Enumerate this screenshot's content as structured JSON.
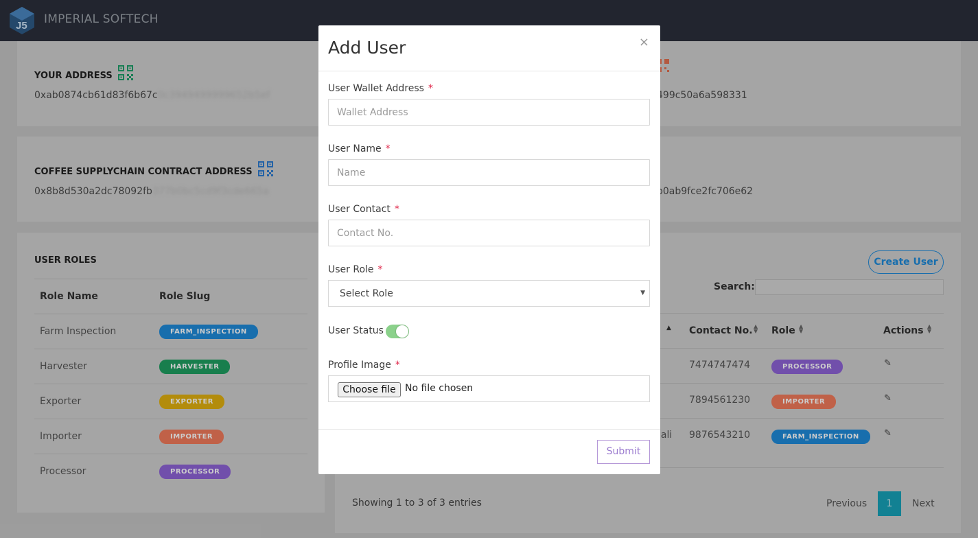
{
  "brand": {
    "name": "IMPERIAL SOFTECH"
  },
  "addresses": {
    "your_address_title": "YOUR ADDRESS",
    "your_address_value": "0xab0874cb61d83f6b67c",
    "your_address_hidden": "0c3949499999652b5ef",
    "right_top_value": "499c50a6a598331",
    "contract_title": "COFFEE SUPPLYCHAIN CONTRACT ADDRESS",
    "contract_value": "0x8b8d530a2dc78092fb",
    "contract_hidden": "377b0bc5cd9f3cde665a",
    "right_bottom_value": "b0ab9fce2fc706e62"
  },
  "user_roles": {
    "title": "USER ROLES",
    "headers": [
      "Role Name",
      "Role Slug"
    ],
    "rows": [
      {
        "name": "Farm Inspection",
        "slug": "FARM_INSPECTION",
        "color": "#1f8ad9"
      },
      {
        "name": "Harvester",
        "slug": "HARVESTER",
        "color": "#1f9e61"
      },
      {
        "name": "Exporter",
        "slug": "EXPORTER",
        "color": "#e0b010"
      },
      {
        "name": "Importer",
        "slug": "IMPORTER",
        "color": "#f07a5a"
      },
      {
        "name": "Processor",
        "slug": "PROCESSOR",
        "color": "#8e63d6"
      }
    ]
  },
  "users": {
    "create_button": "Create User",
    "search_label": "Search:",
    "search_value": "",
    "headers": [
      "Contact No.",
      "Role",
      "Actions"
    ],
    "rows": [
      {
        "name_tail": "",
        "contact": "7474747474",
        "role": "PROCESSOR",
        "role_color": "#8e63d6"
      },
      {
        "name_tail": "",
        "contact": "7894561230",
        "role": "IMPORTER",
        "role_color": "#f07a5a"
      },
      {
        "name_tail": "nali",
        "contact": "9876543210",
        "role": "FARM_INSPECTION",
        "role_color": "#1f8ad9"
      }
    ],
    "showing": "Showing 1 to 3 of 3 entries",
    "pagination": {
      "previous": "Previous",
      "page": "1",
      "next": "Next"
    }
  },
  "modal": {
    "title": "Add User",
    "close": "×",
    "wallet_label": "User Wallet Address",
    "wallet_placeholder": "Wallet Address",
    "name_label": "User Name",
    "name_placeholder": "Name",
    "contact_label": "User Contact",
    "contact_placeholder": "Contact No.",
    "role_label": "User Role",
    "role_selected": "Select Role",
    "status_label": "User Status",
    "status_on": true,
    "image_label": "Profile Image",
    "choose_file": "Choose file",
    "no_file": "No file chosen",
    "required_mark": "*",
    "submit": "Submit"
  },
  "colors": {
    "accent": "#1f8ad9",
    "teal": "#17a2b8",
    "required": "#e0284b",
    "submit": "#9b7bcf"
  }
}
